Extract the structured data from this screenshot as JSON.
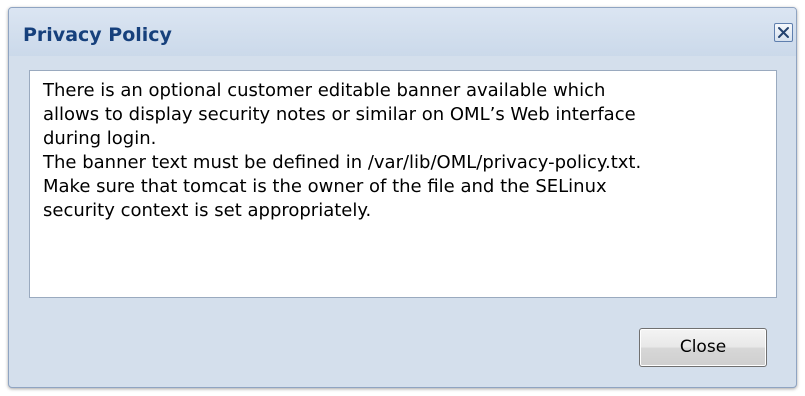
{
  "dialog": {
    "title": "Privacy Policy",
    "message_lines": [
      "There is an optional customer editable banner available which",
      "allows to display security notes or similar on OML’s Web interface",
      "during login.",
      "The banner text must be defined in /var/lib/OML/privacy-policy.txt.",
      "Make sure that tomcat is the owner of the file and the SELinux",
      "security context is set appropriately."
    ],
    "close_button_label": "Close",
    "close_icon": "close-icon"
  },
  "colors": {
    "title_text": "#16407c",
    "dialog_background": "#d4dfec",
    "panel_background": "#ffffff",
    "border": "#8fa4c2"
  }
}
